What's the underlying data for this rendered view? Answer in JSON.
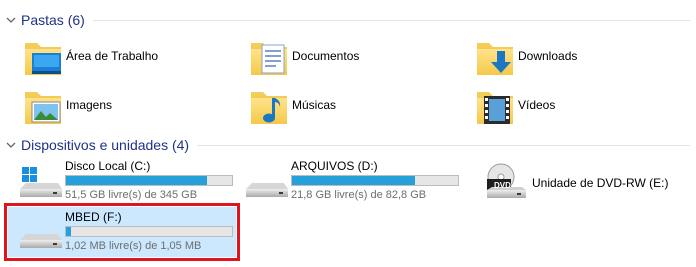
{
  "folders_group": {
    "title": "Pastas (6)"
  },
  "folders": [
    {
      "name": "Área de Trabalho",
      "icon": "desktop-folder-icon"
    },
    {
      "name": "Documentos",
      "icon": "documents-folder-icon"
    },
    {
      "name": "Downloads",
      "icon": "downloads-folder-icon"
    },
    {
      "name": "Imagens",
      "icon": "pictures-folder-icon"
    },
    {
      "name": "Músicas",
      "icon": "music-folder-icon"
    },
    {
      "name": "Vídeos",
      "icon": "videos-folder-icon"
    }
  ],
  "drives_group": {
    "title": "Dispositivos e unidades (4)"
  },
  "drives": [
    {
      "name": "Disco Local (C:)",
      "free_text": "51,5 GB livre(s) de 345 GB",
      "used_fraction": 0.85,
      "icon": "windows-drive-icon"
    },
    {
      "name": "ARQUIVOS (D:)",
      "free_text": "21,8 GB livre(s) de 82,8 GB",
      "used_fraction": 0.74,
      "icon": "hard-drive-icon"
    },
    {
      "name": "Unidade de DVD-RW (E:)",
      "icon": "dvd-drive-icon"
    },
    {
      "name": "MBED (F:)",
      "free_text": "1,02 MB livre(s) de 1,05 MB",
      "used_fraction": 0.03,
      "icon": "usb-drive-icon",
      "selected": true
    }
  ],
  "colors": {
    "accent": "#26a0da",
    "header_text": "#1e3287",
    "selection": "#cce8ff",
    "highlight_frame": "#e0141e"
  }
}
